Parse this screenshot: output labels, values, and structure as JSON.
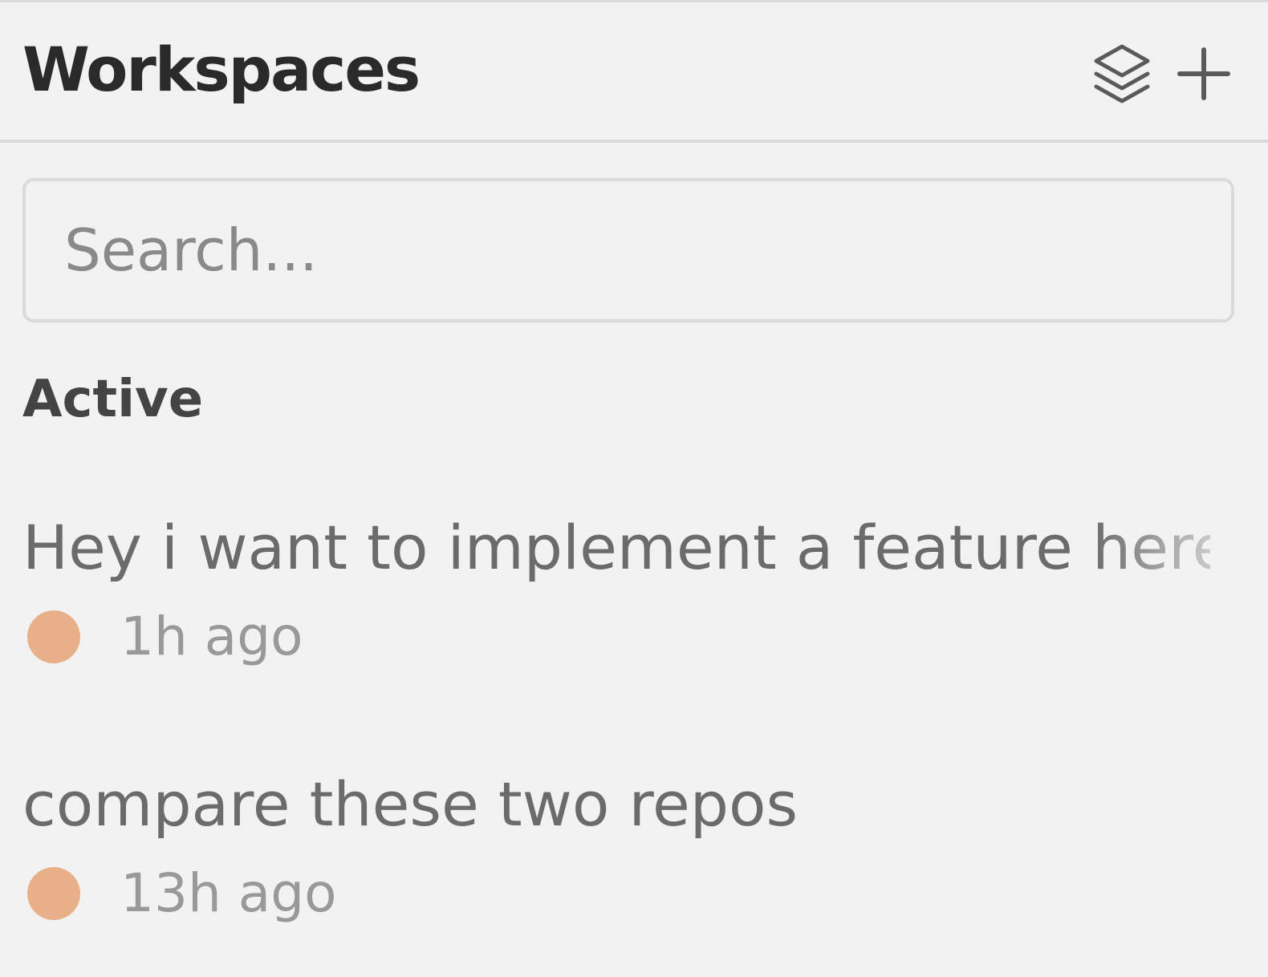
{
  "header": {
    "title": "Workspaces",
    "icons": {
      "layers": "layers-icon",
      "add": "plus-icon"
    }
  },
  "search": {
    "placeholder": "Search...",
    "value": ""
  },
  "sections": [
    {
      "label": "Active",
      "items": [
        {
          "title": "Hey i want to implement a feature here",
          "time": "1h ago",
          "status_color": "#e8b089"
        },
        {
          "title": "compare these two repos",
          "time": "13h ago",
          "status_color": "#e8b089"
        }
      ]
    }
  ],
  "colors": {
    "background": "#f2f2f2",
    "status_active": "#e8b089"
  }
}
